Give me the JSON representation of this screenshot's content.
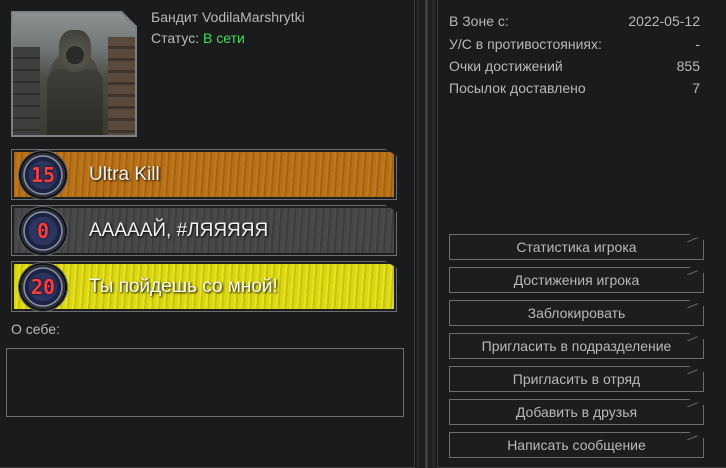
{
  "profile": {
    "username": "Бандит VodilaMarshrytki",
    "status_label": "Статус:",
    "status_value": "В сети"
  },
  "achievements": [
    {
      "badge": "15",
      "title": "Ultra Kill",
      "color": "#b8711a"
    },
    {
      "badge": "0",
      "title": "АААААЙ, #ЛЯЯЯЯЯ",
      "color": "#464748"
    },
    {
      "badge": "20",
      "title": "Ты пойдешь со мной!",
      "color": "#dcd716"
    }
  ],
  "about": {
    "label": "О себе:",
    "text": ""
  },
  "stats": [
    {
      "label": "В Зоне с:",
      "value": "2022-05-12"
    },
    {
      "label": "У/С в противостояниях:",
      "value": "-"
    },
    {
      "label": "Очки достижений",
      "value": "855"
    },
    {
      "label": "Посылок доставлено",
      "value": "7"
    }
  ],
  "actions": [
    "Статистика игрока",
    "Достижения игрока",
    "Заблокировать",
    "Пригласить в подразделение",
    "Пригласить в отряд",
    "Добавить в друзья",
    "Написать сообщение"
  ],
  "colors": {
    "online": "#3ee05a",
    "badge_digits": "#ff3b3b"
  }
}
